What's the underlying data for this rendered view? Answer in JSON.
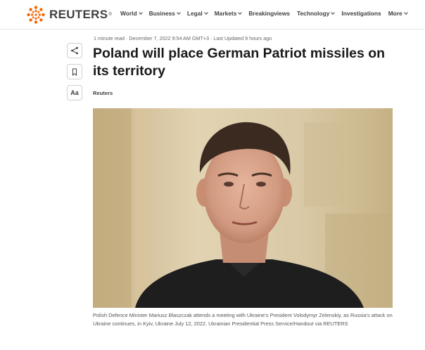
{
  "header": {
    "brand": "REUTERS",
    "brand_mark": "®",
    "nav": [
      {
        "label": "World",
        "has_menu": true
      },
      {
        "label": "Business",
        "has_menu": true
      },
      {
        "label": "Legal",
        "has_menu": true
      },
      {
        "label": "Markets",
        "has_menu": true
      },
      {
        "label": "Breakingviews",
        "has_menu": false
      },
      {
        "label": "Technology",
        "has_menu": true
      },
      {
        "label": "Investigations",
        "has_menu": false
      },
      {
        "label": "More",
        "has_menu": true
      }
    ]
  },
  "article": {
    "meta": "1 minute read · December 7, 2022 9:54 AM GMT+3 · Last Updated 9 hours ago",
    "headline": "Poland will place German Patriot missiles on its territory",
    "byline": "Reuters",
    "tools": {
      "share_icon": "share-icon",
      "bookmark_icon": "bookmark-icon",
      "text_size_label": "Aa"
    },
    "caption": "Polish Defence Minister Mariusz Blaszczak attends a meeting with Ukraine's President Volodymyr Zelenskiy, as Russia's attack on Ukraine continues, in Kyiv, Ukraine July 12, 2022. Ukrainian Presidential Press Service/Handout via REUTERS"
  },
  "colors": {
    "brand_orange": "#fa6400",
    "text_dark": "#1a1a1a",
    "text_muted": "#666666"
  }
}
